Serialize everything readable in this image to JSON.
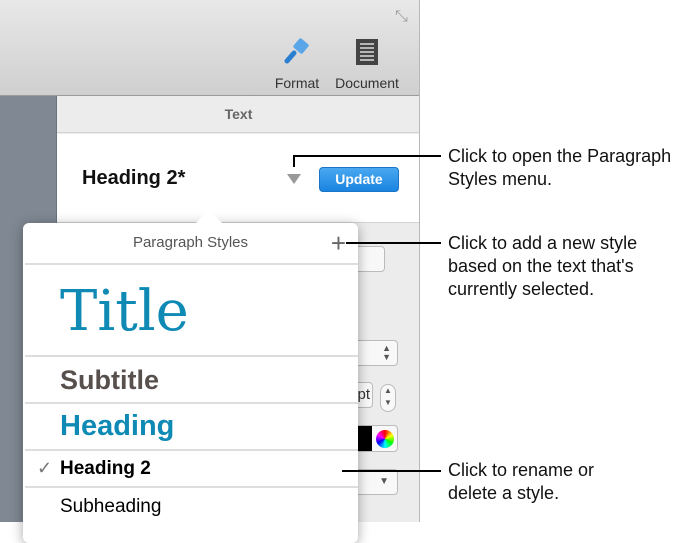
{
  "toolbar": {
    "format_label": "Format",
    "document_label": "Document"
  },
  "panel": {
    "tab_label": "Text",
    "current_style": "Heading 2*",
    "update_label": "Update",
    "size_unit": "pt"
  },
  "popover": {
    "title": "Paragraph Styles",
    "add_label": "+",
    "items": [
      {
        "label": "Title",
        "selected": false
      },
      {
        "label": "Subtitle",
        "selected": false
      },
      {
        "label": "Heading",
        "selected": false
      },
      {
        "label": "Heading 2",
        "selected": true,
        "check": "✓"
      },
      {
        "label": "Subheading",
        "selected": false
      }
    ]
  },
  "callouts": [
    "Click to open the Paragraph Styles menu.",
    "Click to add a new style based on the text that's currently selected.",
    "Click to rename or delete a style."
  ],
  "colors": {
    "accent": "#1a84e0",
    "title": "#0f8ab5",
    "subtitle": "#58504c"
  }
}
